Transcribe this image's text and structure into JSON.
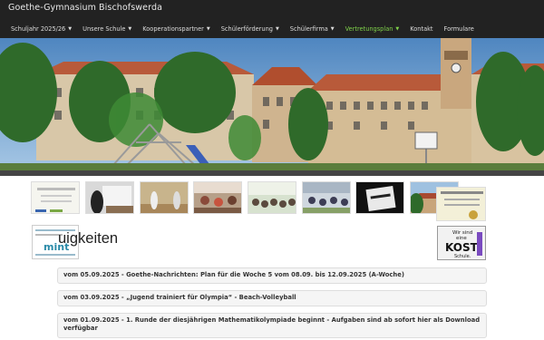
{
  "site": {
    "brand": "Goethe-Gymnasium Bischofswerda"
  },
  "nav": {
    "items": [
      {
        "label": "Schuljahr 2025/26",
        "dropdown": true,
        "active": false
      },
      {
        "label": "Unsere Schule",
        "dropdown": true,
        "active": false
      },
      {
        "label": "Kooperationspartner",
        "dropdown": true,
        "active": false
      },
      {
        "label": "Schülerförderung",
        "dropdown": true,
        "active": false
      },
      {
        "label": "Schülerfirma",
        "dropdown": true,
        "active": false
      },
      {
        "label": "Vertretungsplan",
        "dropdown": true,
        "active": true
      },
      {
        "label": "Kontakt",
        "dropdown": false,
        "active": false
      },
      {
        "label": "Formulare",
        "dropdown": false,
        "active": false
      }
    ]
  },
  "page": {
    "heading": "Neuigkeiten",
    "heading_visible": "uigkeiten"
  },
  "badges": {
    "kost": {
      "line1": "Wir sind",
      "line2": "eine",
      "big": "KOST",
      "line3": "Schule."
    },
    "mint": {
      "text": "MINT"
    }
  },
  "news": [
    {
      "title": "vom 05.09.2025 - Goethe-Nachrichten: Plan für die Woche 5 vom 08.09. bis 12.09.2025 (A-Woche)"
    },
    {
      "title": "vom 03.09.2025 - „Jugend trainiert für Olympia“ - Beach-Volleyball"
    },
    {
      "title": "vom 01.09.2025 - 1. Runde der diesjährigen Mathematikolympiade beginnt - Aufgaben sind ab sofort hier als Download verfügbar"
    }
  ],
  "colors": {
    "navbar": "#222222",
    "active": "#7fd14a",
    "panel": "#f5f5f5"
  }
}
